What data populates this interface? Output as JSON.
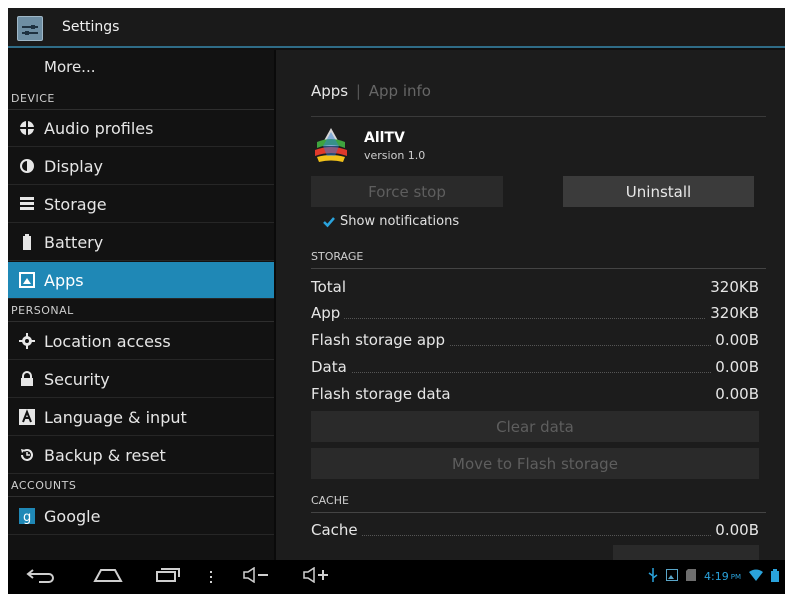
{
  "titlebar": {
    "title": "Settings"
  },
  "sidebar": {
    "more": "More...",
    "headers": {
      "device": "DEVICE",
      "personal": "PERSONAL",
      "accounts": "ACCOUNTS"
    },
    "items": [
      {
        "label": "Audio profiles",
        "icon": "audio-profiles-icon"
      },
      {
        "label": "Display",
        "icon": "display-icon"
      },
      {
        "label": "Storage",
        "icon": "storage-icon"
      },
      {
        "label": "Battery",
        "icon": "battery-icon"
      },
      {
        "label": "Apps",
        "icon": "apps-icon",
        "selected": true
      },
      {
        "label": "Location access",
        "icon": "location-icon"
      },
      {
        "label": "Security",
        "icon": "lock-icon"
      },
      {
        "label": "Language & input",
        "icon": "language-icon"
      },
      {
        "label": "Backup & reset",
        "icon": "backup-icon"
      },
      {
        "label": "Google",
        "icon": "google-icon"
      }
    ]
  },
  "content": {
    "breadcrumb": {
      "apps": "Apps",
      "sep": "|",
      "app_info": "App info"
    },
    "app": {
      "name": "AllTV",
      "version": "version 1.0"
    },
    "buttons": {
      "force_stop": "Force stop",
      "uninstall": "Uninstall",
      "clear_data": "Clear data",
      "move": "Move to Flash storage"
    },
    "show_notifications": {
      "label": "Show notifications",
      "checked": true
    },
    "storage": {
      "header": "STORAGE",
      "rows": [
        {
          "label": "Total",
          "value": "320KB",
          "dots": false
        },
        {
          "label": "App",
          "value": "320KB",
          "dots": true
        },
        {
          "label": "Flash storage app",
          "value": "0.00B",
          "dots": true
        },
        {
          "label": "Data",
          "value": "0.00B",
          "dots": true
        },
        {
          "label": "Flash storage data",
          "value": "0.00B",
          "dots": false
        }
      ]
    },
    "cache": {
      "header": "CACHE",
      "row": {
        "label": "Cache",
        "value": "0.00B"
      }
    }
  },
  "statusbar": {
    "time": "4:19",
    "ampm": "PM"
  },
  "colors": {
    "accent": "#1f88b6",
    "titlebar_line": "#2f6c87"
  }
}
